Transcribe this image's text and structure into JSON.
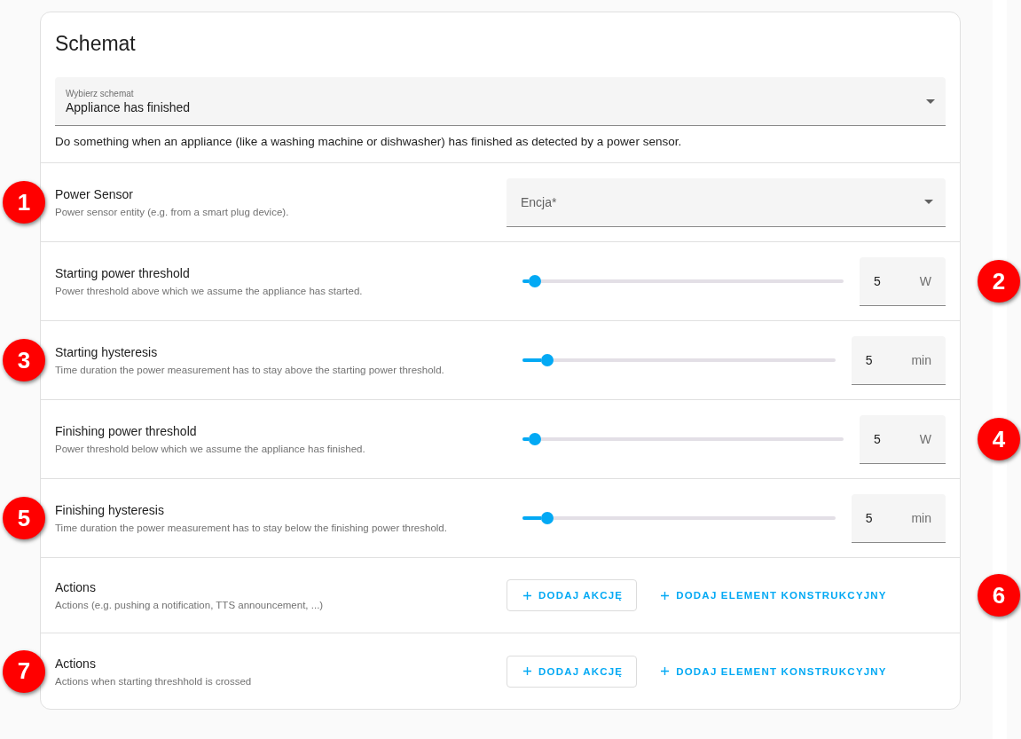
{
  "card": {
    "title": "Schemat",
    "blueprint_select": {
      "label": "Wybierz schemat",
      "value": "Appliance has finished"
    },
    "description": "Do something when an appliance (like a washing machine or dishwasher) has finished as detected by a power sensor."
  },
  "rows": [
    {
      "kind": "entity",
      "title": "Power Sensor",
      "description": "Power sensor entity (e.g. from a smart plug device).",
      "placeholder": "Encja*",
      "badge": "1"
    },
    {
      "kind": "number",
      "title": "Starting power threshold",
      "description": "Power threshold above which we assume the appliance has started.",
      "level": 0.04,
      "value": "5",
      "unit": "W",
      "badge": "2"
    },
    {
      "kind": "number",
      "title": "Starting hysteresis",
      "description": "Time duration the power measurement has to stay above the starting power threshold.",
      "level": 0.08,
      "value": "5",
      "unit": "min",
      "badge": "3"
    },
    {
      "kind": "number",
      "title": "Finishing power threshold",
      "description": "Power threshold below which we assume the appliance has finished.",
      "level": 0.04,
      "value": "5",
      "unit": "W",
      "badge": "4"
    },
    {
      "kind": "number",
      "title": "Finishing hysteresis",
      "description": "Time duration the power measurement has to stay below the finishing power threshold.",
      "level": 0.08,
      "value": "5",
      "unit": "min",
      "badge": "5"
    },
    {
      "kind": "actions",
      "title": "Actions",
      "description": "Actions (e.g. pushing a notification, TTS announcement, ...)",
      "buttons": [
        "DODAJ AKCJĘ",
        "DODAJ ELEMENT KONSTRUKCYJNY"
      ],
      "badge": "6"
    },
    {
      "kind": "actions",
      "title": "Actions",
      "description": "Actions when starting threshhold is crossed",
      "buttons": [
        "DODAJ AKCJĘ",
        "DODAJ ELEMENT KONSTRUKCYJNY"
      ],
      "badge": "7"
    }
  ]
}
